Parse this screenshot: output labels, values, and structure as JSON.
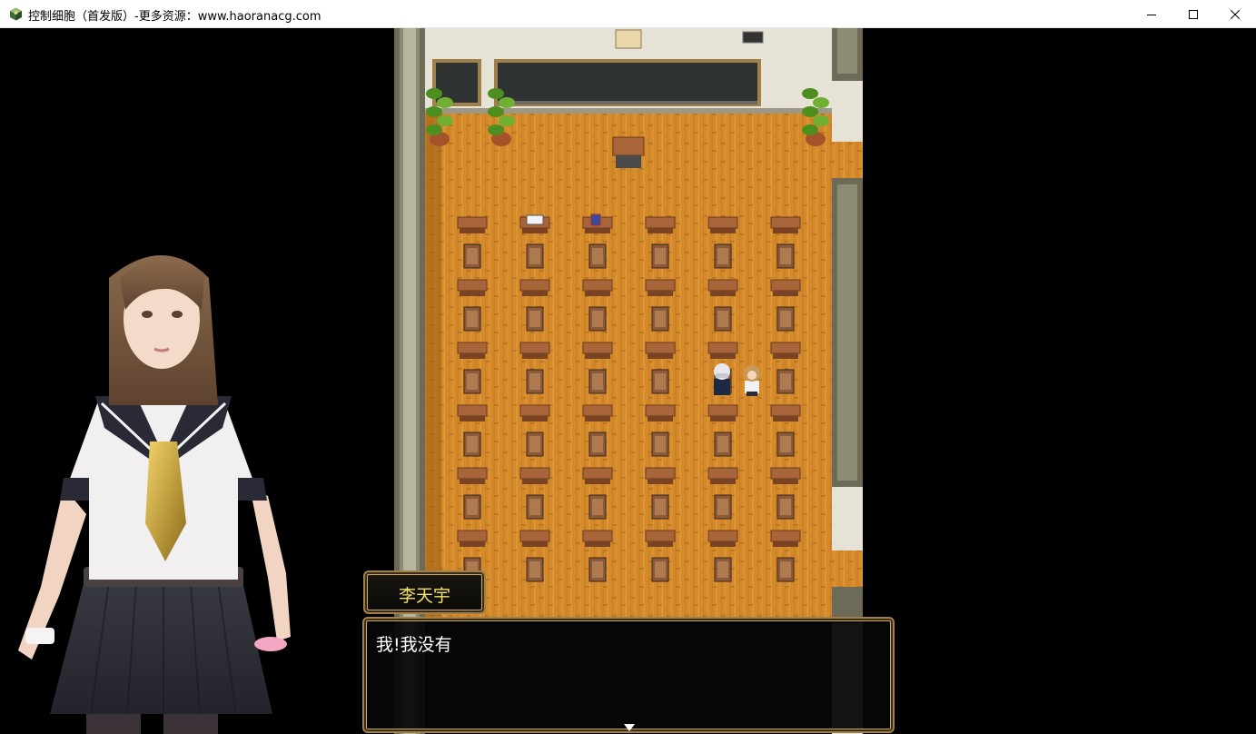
{
  "window": {
    "title": "控制细胞（首发版）-更多资源：www.haoranacg.com",
    "icon": "game-cube-icon",
    "controls": [
      "minimize-icon",
      "maximize-icon",
      "close-icon"
    ]
  },
  "scene": {
    "location": "classroom",
    "colors": {
      "floor": "#d48a2a",
      "wall": "#e6e3d6",
      "blackboard": "#2f3432",
      "frame": "#a0804a"
    }
  },
  "dialogue": {
    "speaker": "李天宇",
    "message": "我!我没有",
    "speaker_color": "#f3e26a",
    "continue_indicator": "down-triangle-icon"
  }
}
